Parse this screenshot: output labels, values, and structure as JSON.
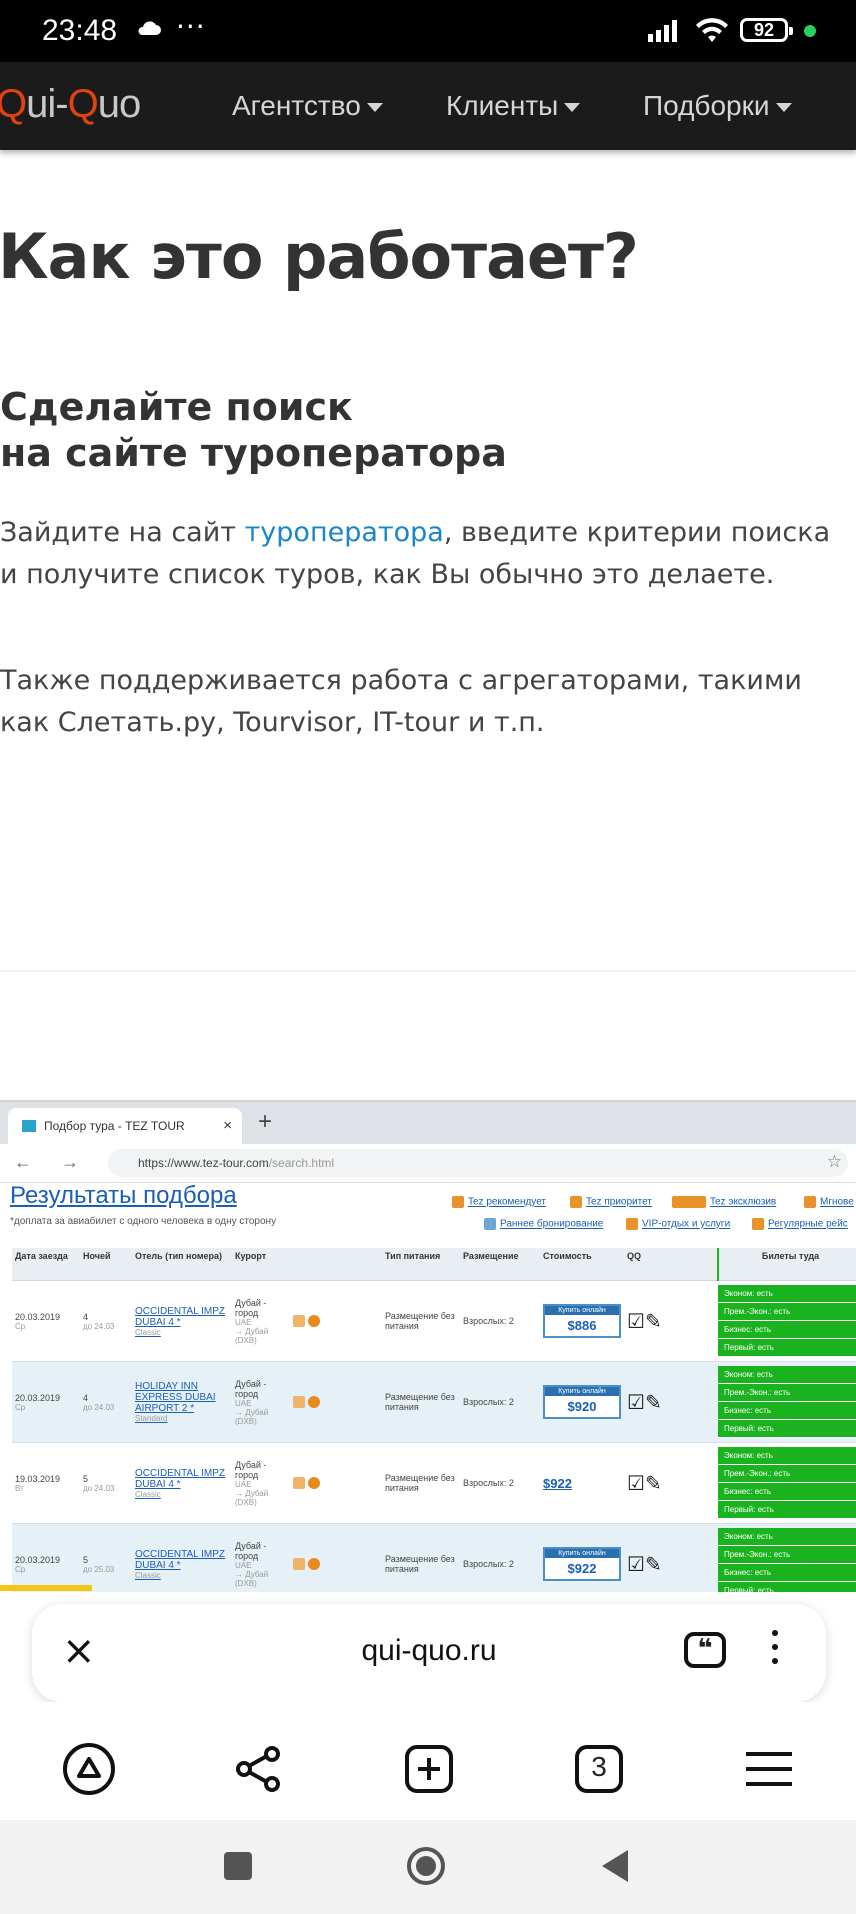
{
  "status_bar": {
    "time": "23:48",
    "dots": "···",
    "battery": "92"
  },
  "navbar": {
    "logo_q1": "Q",
    "logo_mid": "ui-",
    "logo_q2": "Q",
    "logo_end": "uo",
    "items": [
      "Агентство",
      "Клиенты",
      "Подборки"
    ]
  },
  "page": {
    "title": "Как это работает?",
    "step_title_line1": "Сделайте поиск",
    "step_title_line2": "на сайте туроператора",
    "para1_before": "Зайдите на сайт ",
    "para1_link": "туроператора",
    "para1_after": ", введите критерии поиска и получите список туров, как Вы обычно это делаете.",
    "para2": "Также поддерживается работа с агрегаторами, такими как Слетать.ру, Tourvisor, IT-tour и т.п."
  },
  "screenshot": {
    "tab_title": "Подбор тура - TEZ TOUR",
    "tab_close": "×",
    "new_tab": "+",
    "nav_glyphs": "← → C",
    "url_host": "https://www.tez-tour.com",
    "url_path": "/search.html",
    "results_title": "Результаты подбора",
    "results_sub": "*доплата за авиабилет с одного человека в одну сторону",
    "promos": [
      "Tez рекомендует",
      "Tez приоритет",
      "Tez эксклюзив",
      "Мгнове",
      "Раннее бронирование",
      "VIP-отдых и услуги",
      "Регулярные рейс"
    ],
    "headers": [
      "Дата заезда",
      "Ночей",
      "Отель (тип номера)",
      "Курорт",
      "",
      "Тип питания",
      "Размещение",
      "Стоимость",
      "QQ",
      "Билеты туда"
    ],
    "rows": [
      {
        "date": "20.03.2019",
        "day": "Ср",
        "nights": "4",
        "till": "до 24.03",
        "hotel": "OCCIDENTAL IMPZ DUBAI 4 *",
        "room": "Classic",
        "resort": "Дубай - город",
        "country": "UAE",
        "airport": "→ Дубай (DXB)",
        "meal": "Размещение без питания",
        "place": "Взрослых: 2",
        "buy": "Купить онлайн",
        "price": "$886",
        "online": true
      },
      {
        "date": "20.03.2019",
        "day": "Ср",
        "nights": "4",
        "till": "до 24.03",
        "hotel": "HOLIDAY INN EXPRESS DUBAI AIRPORT 2 *",
        "room": "Standard",
        "resort": "Дубай - город",
        "country": "UAE",
        "airport": "→ Дубай (DXB)",
        "meal": "Размещение без питания",
        "place": "Взрослых: 2",
        "buy": "Купить онлайн",
        "price": "$920",
        "online": true
      },
      {
        "date": "19.03.2019",
        "day": "Вт",
        "nights": "5",
        "till": "до 24.03",
        "hotel": "OCCIDENTAL IMPZ DUBAI 4 *",
        "room": "Classic",
        "resort": "Дубай - город",
        "country": "UAE",
        "airport": "→ Дубай (DXB)",
        "meal": "Размещение без питания",
        "place": "Взрослых: 2",
        "buy": "",
        "price": "$922",
        "online": false
      },
      {
        "date": "20.03.2019",
        "day": "Ср",
        "nights": "5",
        "till": "до 25.03",
        "hotel": "OCCIDENTAL IMPZ DUBAI 4 *",
        "room": "Classic",
        "resort": "Дубай - город",
        "country": "UAE",
        "airport": "→ Дубай (DXB)",
        "meal": "Размещение без питания",
        "place": "Взрослых: 2",
        "buy": "Купить онлайн",
        "price": "$922",
        "online": true
      }
    ],
    "tickets": [
      "Эконом: есть",
      "Прем.-Экон.: есть",
      "Бизнес: есть",
      "Первый: есть"
    ]
  },
  "browser": {
    "close": "×",
    "url": "qui-quo.ru",
    "quote_glyph": "❝",
    "tab_count": "3"
  },
  "colors": {
    "accent_logo": "#e2430d",
    "link": "#1a86c8",
    "progress": "#f5c518",
    "ticket_green": "#1bb21f"
  }
}
